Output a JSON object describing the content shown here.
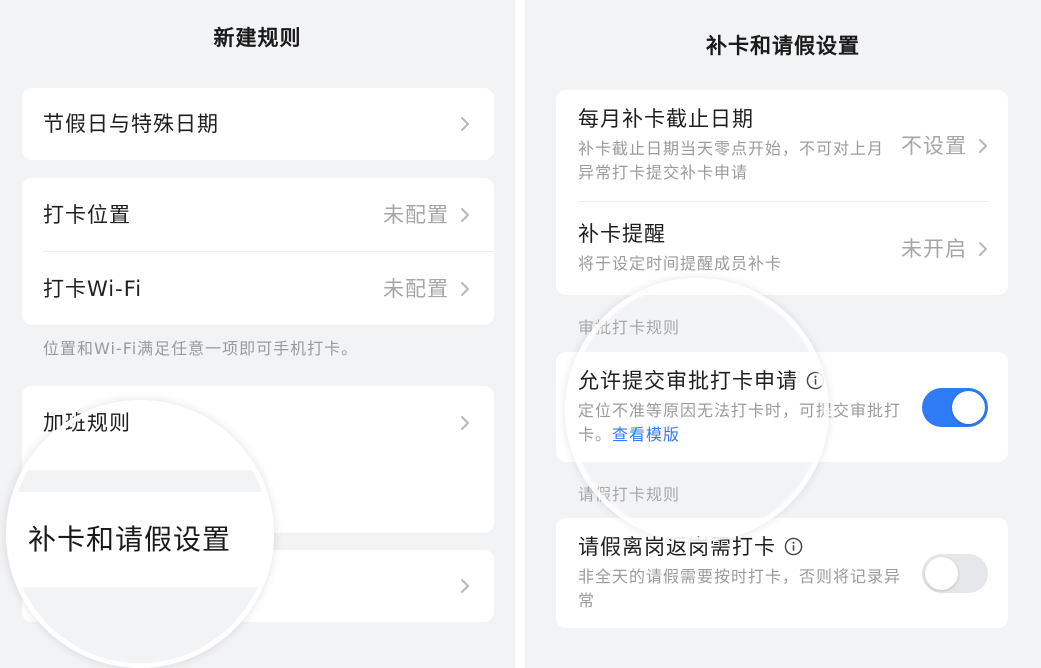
{
  "left": {
    "title": "新建规则",
    "holiday": {
      "label": "节假日与特殊日期"
    },
    "location": {
      "label": "打卡位置",
      "value": "未配置"
    },
    "wifi": {
      "label": "打卡Wi-Fi",
      "value": "未配置"
    },
    "location_note": "位置和Wi-Fi满足任意一项即可手机打卡。",
    "overtime": {
      "label": "加班规则"
    },
    "magnifier_label": "补卡和请假设置"
  },
  "right": {
    "title": "补卡和请假设置",
    "deadline": {
      "title": "每月补卡截止日期",
      "desc_lines": [
        "补卡截止日期当天零点开始，不可对上月",
        "异常打卡提交补卡申请"
      ],
      "value": "不设置"
    },
    "reminder": {
      "title": "补卡提醒",
      "desc_lines": [
        "将于设定时间提醒成员补卡"
      ],
      "value": "未开启"
    },
    "approval_section": "审批打卡规则",
    "approval": {
      "title": "允许提交审批打卡申请",
      "desc_lines": [
        "定位不准等原因无法打卡时，可提交审批打",
        "卡。"
      ],
      "link": "查看模版",
      "enabled": true
    },
    "leave_section": "请假打卡规则",
    "leave": {
      "title": "请假离岗返岗需打卡",
      "desc_lines": [
        "非全天的请假需要按时打卡，否则将记录异",
        "常"
      ],
      "enabled": false
    }
  },
  "colors": {
    "background": "#f2f3f5",
    "card": "#ffffff",
    "accent": "#2f7bf6",
    "toggle_off": "#e6e7ea"
  },
  "icons": {
    "chevron": "chevron-right-icon",
    "info": "info-icon"
  }
}
